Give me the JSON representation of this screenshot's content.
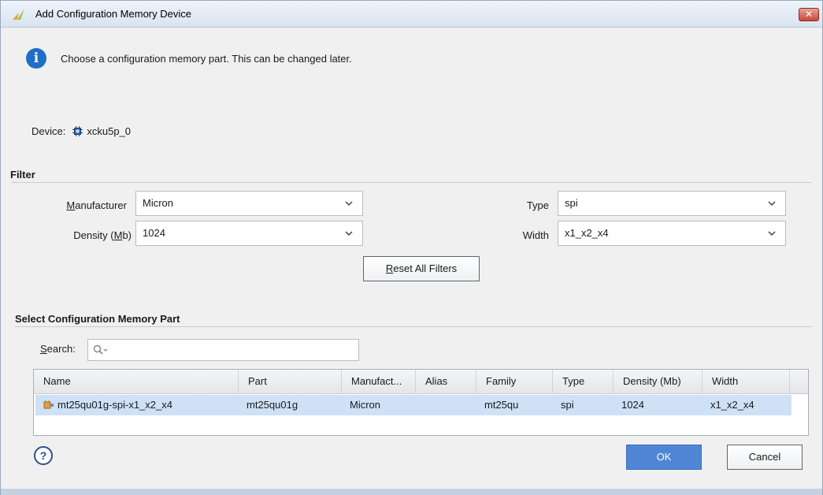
{
  "window": {
    "title": "Add Configuration Memory Device",
    "close_symbol": "✕",
    "icons": {
      "app": "vivado-logo-icon",
      "close": "close-icon"
    }
  },
  "info": {
    "icon": "info-icon",
    "message": "Choose a configuration memory part. This can be changed later."
  },
  "device": {
    "label": "Device:",
    "icon": "chip-icon",
    "value": "xcku5p_0"
  },
  "filter": {
    "title": "Filter",
    "manufacturer": {
      "label_first": "M",
      "label_rest": "anufacturer",
      "value": "Micron"
    },
    "density": {
      "label_before": "Density (",
      "label_key": "M",
      "label_after": "b)",
      "value": "1024"
    },
    "type": {
      "label": "Type",
      "value": "spi"
    },
    "width": {
      "label": "Width",
      "value": "x1_x2_x4"
    },
    "reset": {
      "label_key": "R",
      "label_rest": "eset All Filters"
    }
  },
  "select": {
    "title": "Select Configuration Memory Part",
    "search": {
      "label_key": "S",
      "label_rest": "earch:",
      "placeholder": "",
      "icon": "search-icon"
    }
  },
  "table": {
    "columns": [
      "Name",
      "Part",
      "Manufact...",
      "Alias",
      "Family",
      "Type",
      "Density (Mb)",
      "Width"
    ],
    "rows": [
      {
        "icon": "memory-part-icon",
        "name": "mt25qu01g-spi-x1_x2_x4",
        "part": "mt25qu01g",
        "manufacturer": "Micron",
        "alias": "",
        "family": "mt25qu",
        "type": "spi",
        "density": "1024",
        "width": "x1_x2_x4"
      }
    ]
  },
  "footer": {
    "help_symbol": "?",
    "help_icon": "help-icon",
    "ok_label": "OK",
    "cancel_label": "Cancel"
  },
  "colors": {
    "accent": "#4f86d6",
    "selected_row": "#cfe1f7",
    "info_blue": "#1f6fc5"
  }
}
